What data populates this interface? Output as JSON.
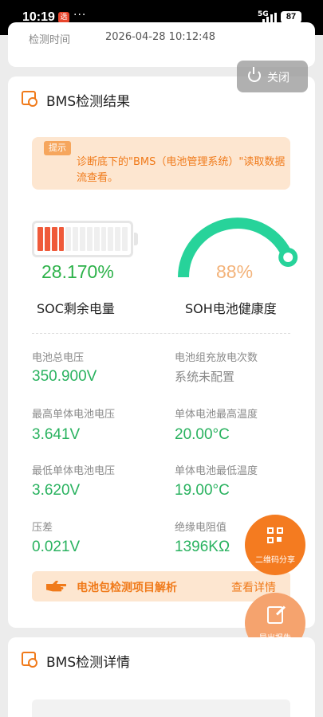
{
  "status_bar": {
    "time": "10:19",
    "notification_badge": "选",
    "more": "···",
    "network": "5G",
    "battery": "87"
  },
  "top_card": {
    "label": "检测时间",
    "value": "2026-04-28 10:12:48"
  },
  "close_button": {
    "label": "关闭",
    "icon": "power-icon"
  },
  "result_section": {
    "title": "BMS检测结果",
    "tip": {
      "tag": "提示",
      "text": "诊断底下的\"BMS（电池管理系统）\"读取数据流查看。"
    },
    "soc": {
      "value": "28.170%",
      "label": "SOC剩余电量",
      "fraction": 0.2817,
      "cells_total": 13,
      "cells_filled": 4
    },
    "soh": {
      "value": "88%",
      "label": "SOH电池健康度",
      "fraction": 0.88
    },
    "metrics": [
      {
        "label": "电池总电压",
        "value": "350.900V",
        "style": "value"
      },
      {
        "label": "电池组充放电次数",
        "value": "系统未配置",
        "style": "plain"
      },
      {
        "label": "最高单体电池电压",
        "value": "3.641V",
        "style": "value"
      },
      {
        "label": "单体电池最高温度",
        "value": "20.00°C",
        "style": "value"
      },
      {
        "label": "最低单体电池电压",
        "value": "3.620V",
        "style": "value"
      },
      {
        "label": "单体电池最低温度",
        "value": "19.00°C",
        "style": "value"
      },
      {
        "label": "压差",
        "value": "0.021V",
        "style": "value"
      },
      {
        "label": "绝缘电阻值",
        "value": "1396KΩ",
        "style": "value"
      }
    ],
    "analysis": {
      "text": "电池包检测项目解析",
      "link": "查看详情",
      "icon": "pointing-hand-icon"
    }
  },
  "fab_qr": {
    "label": "二维码分享",
    "icon": "qr-code-icon"
  },
  "fab_export": {
    "label": "导出报告",
    "icon": "export-report-icon"
  },
  "detail_section": {
    "title": "BMS检测详情"
  },
  "colors": {
    "accent_orange": "#f07a1a",
    "value_green": "#29b25f",
    "soc_green": "#2db24a",
    "soh_gauge_green": "#27d39a",
    "soh_value": "#f3b37a",
    "battery_red": "#ef5a3a",
    "tip_background": "#fde6d0"
  }
}
